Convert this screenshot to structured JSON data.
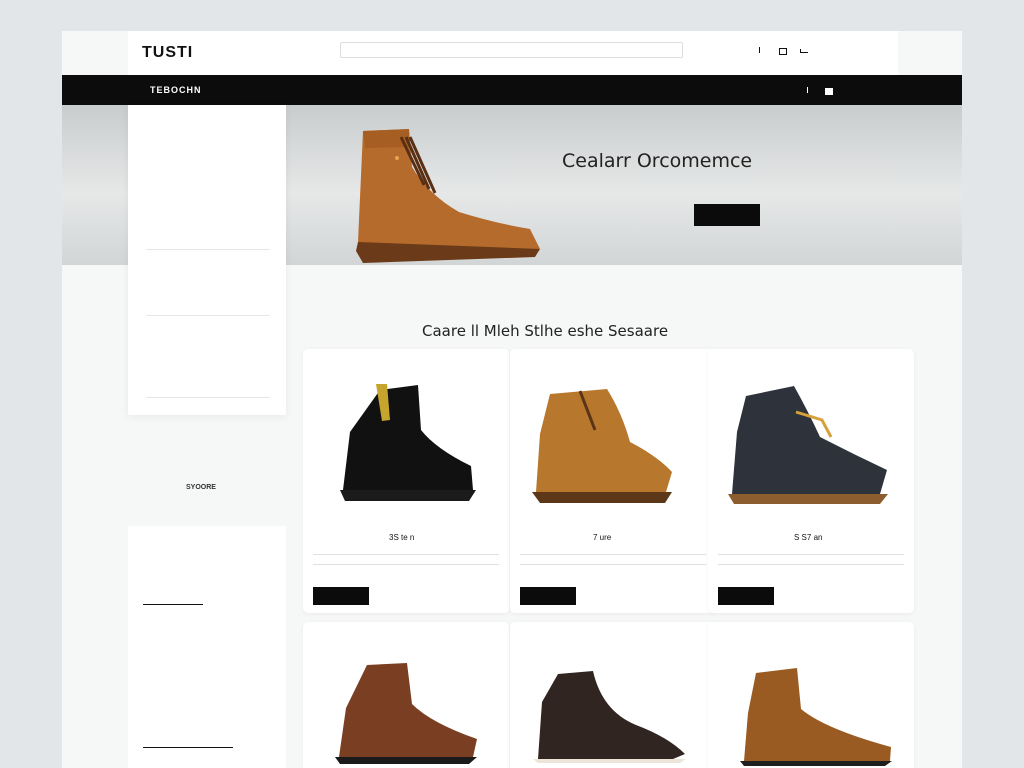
{
  "header": {
    "logo": "TUSTI",
    "top_links": [
      "",
      ""
    ],
    "search": {
      "placeholder": ""
    },
    "top_right": [
      "",
      ""
    ]
  },
  "nav": {
    "brand": "TEBOCHN",
    "items": [
      "",
      "",
      "",
      "",
      ""
    ],
    "right": [
      ""
    ]
  },
  "hero": {
    "small": "",
    "title": "Cealarr Orcomemce",
    "sub": "",
    "button": ""
  },
  "sidebar": {
    "rows": [
      "",
      "",
      "",
      "",
      "",
      "",
      "",
      ""
    ],
    "side_labels": [
      "",
      "SYOORE"
    ]
  },
  "section": {
    "title": "Caare ll Mleh Stlhe eshe Sesaare",
    "subtitle": ""
  },
  "products": [
    {
      "name": "3S te n",
      "price": "",
      "cta": "",
      "rating": ""
    },
    {
      "name": "7 ure",
      "price": "",
      "cta": "",
      "rating": ""
    },
    {
      "name": "S S7 an",
      "price": "",
      "cta": "",
      "rating": ""
    },
    {
      "name": "",
      "price": "",
      "cta": "",
      "rating": ""
    },
    {
      "name": "",
      "price": "",
      "cta": "",
      "rating": ""
    },
    {
      "name": "",
      "price": "",
      "cta": "",
      "rating": ""
    }
  ],
  "lower_sidebar": {
    "title": "",
    "label_a": "",
    "label_b": "",
    "label_c": ""
  }
}
